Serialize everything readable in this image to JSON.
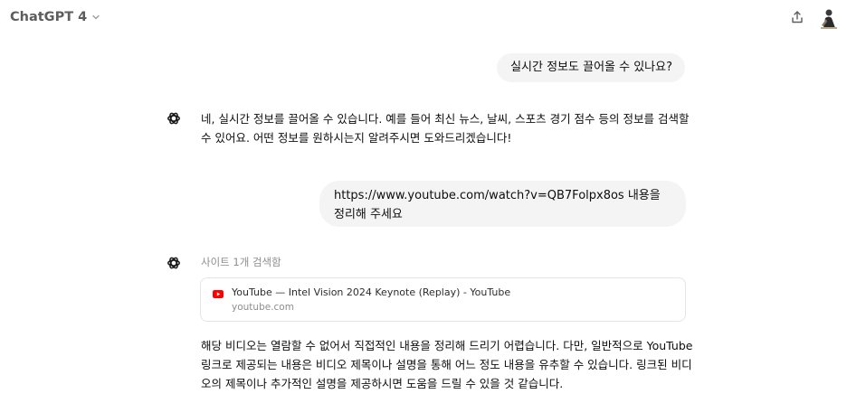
{
  "header": {
    "model_name": "ChatGPT 4"
  },
  "conversation": {
    "user_message_1": "실시간 정보도 끌어올 수 있나요?",
    "assistant_reply_1": "네, 실시간 정보를 끌어올 수 있습니다. 예를 들어 최신 뉴스, 날씨, 스포츠 경기 점수 등의 정보를 검색할 수 있어요. 어떤 정보를 원하시는지 알려주시면 도와드리겠습니다!",
    "user_message_2": "https://www.youtube.com/watch?v=QB7Folpx8os 내용을 정리해 주세요",
    "search_status": "사이트 1개 검색함",
    "source": {
      "title": "YouTube — Intel Vision 2024 Keynote (Replay) - YouTube",
      "domain": "youtube.com"
    },
    "assistant_reply_2": "해당 비디오는 열람할 수 없어서 직접적인 내용을 정리해 드리기 어렵습니다. 다만, 일반적으로 YouTube 링크로 제공되는 내용은 비디오 제목이나 설명을 통해 어느 정도 내용을 유추할 수 있습니다. 링크된 비디오의 제목이나 추가적인 설명을 제공하시면 도움을 드릴 수 있을 것 같습니다."
  },
  "icons": {
    "model_dropdown": "chevron-down-icon",
    "share": "share-icon",
    "assistant": "openai-logo-icon",
    "source_favicon": "youtube-icon"
  },
  "colors": {
    "bubble_bg": "#f4f4f4",
    "youtube_red": "#ff0000",
    "muted_text": "#8e8e8e"
  }
}
